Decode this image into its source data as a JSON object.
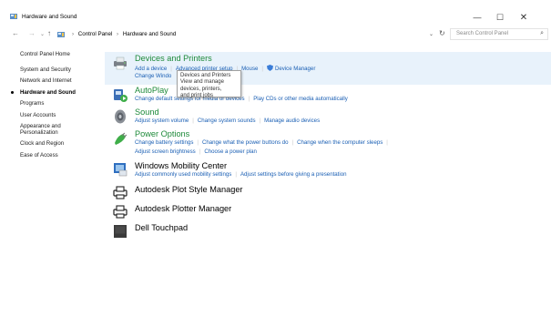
{
  "window": {
    "title": "Hardware and Sound",
    "minimize_glyph": "—",
    "maximize_glyph": "☐",
    "close_glyph": "✕"
  },
  "nav": {
    "back_glyph": "←",
    "forward_glyph": "→",
    "recent_glyph": "⌄",
    "up_glyph": "↑",
    "breadcrumb": [
      "Control Panel",
      "Hardware and Sound"
    ],
    "breadcrumb_sep": "›",
    "dropdown_glyph": "⌄",
    "refresh_glyph": "↻",
    "search_placeholder": "Search Control Panel",
    "search_glyph": "⌕"
  },
  "sidebar": {
    "items": [
      {
        "label": "Control Panel Home",
        "active": false
      },
      {
        "label": "System and Security",
        "active": false
      },
      {
        "label": "Network and Internet",
        "active": false
      },
      {
        "label": "Hardware and Sound",
        "active": true
      },
      {
        "label": "Programs",
        "active": false
      },
      {
        "label": "User Accounts",
        "active": false
      },
      {
        "label": "Appearance and Personalization",
        "active": false
      },
      {
        "label": "Clock and Region",
        "active": false
      },
      {
        "label": "Ease of Access",
        "active": false
      }
    ]
  },
  "groups": {
    "devices": {
      "title": "Devices and Printers",
      "links1": [
        "Add a device",
        "Advanced printer setup",
        "Mouse",
        "Device Manager"
      ],
      "links2": [
        "Change Windo"
      ],
      "icon": "printer-icon"
    },
    "autoplay": {
      "title": "AutoPlay",
      "links1": [
        "Change default settings for media or devices",
        "Play CDs or other media automatically"
      ],
      "icon": "autoplay-icon"
    },
    "sound": {
      "title": "Sound",
      "links1": [
        "Adjust system volume",
        "Change system sounds",
        "Manage audio devices"
      ],
      "icon": "speaker-icon"
    },
    "power": {
      "title": "Power Options",
      "links1": [
        "Change battery settings",
        "Change what the power buttons do",
        "Change when the computer sleeps"
      ],
      "links2": [
        "Adjust screen brightness",
        "Choose a power plan"
      ],
      "icon": "power-plug-icon"
    },
    "mobility": {
      "title": "Windows Mobility Center",
      "links1": [
        "Adjust commonly used mobility settings",
        "Adjust settings before giving a presentation"
      ],
      "icon": "mobility-center-icon"
    },
    "plotstyle": {
      "title": "Autodesk Plot Style Manager",
      "icon": "plotter-icon"
    },
    "plotter": {
      "title": "Autodesk Plotter Manager",
      "icon": "plotter-icon"
    },
    "touchpad": {
      "title": "Dell Touchpad",
      "icon": "touchpad-icon"
    }
  },
  "tooltip": {
    "line1": "Devices and Printers",
    "line2": "View and manage devices, printers,",
    "line3": "and print jobs"
  },
  "colors": {
    "link": "#1a5fb4",
    "group_title": "#1e8a3a",
    "highlight": "#e8f2fb"
  }
}
